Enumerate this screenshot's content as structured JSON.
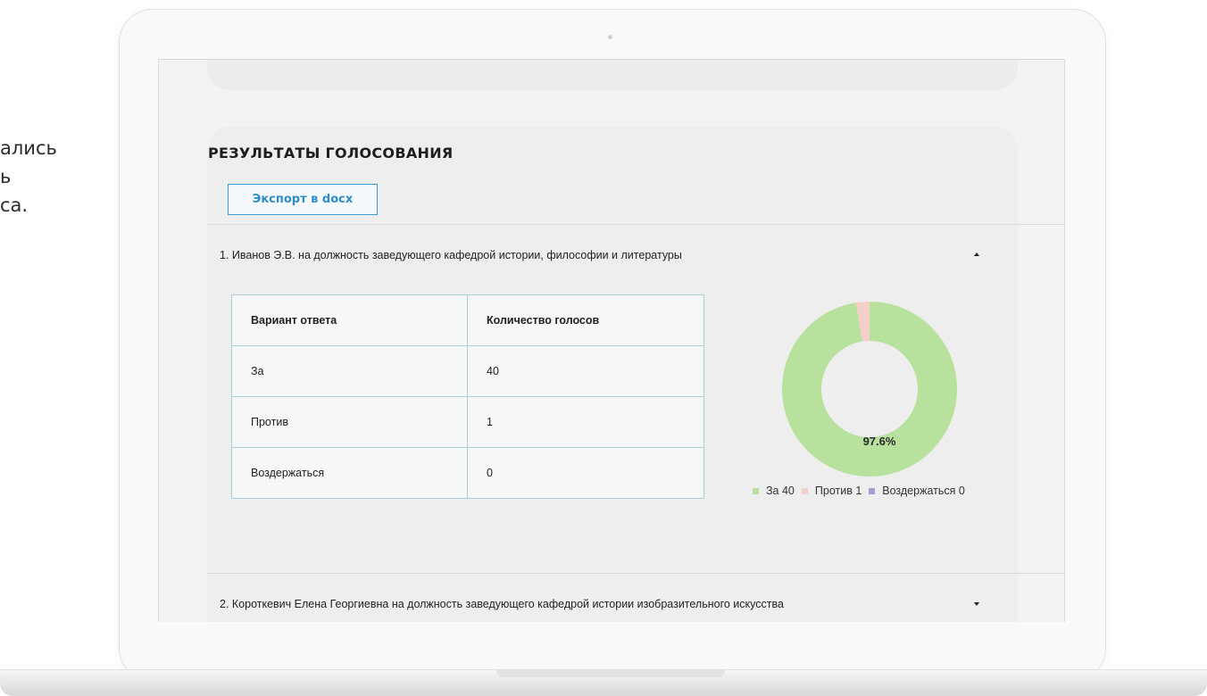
{
  "side_text": {
    "lines": [
      "ались",
      "ь",
      "",
      "са."
    ]
  },
  "results": {
    "title": "РЕЗУЛЬТАТЫ ГОЛОСОВАНИЯ",
    "export_label": "Экспорт в docx",
    "items": [
      {
        "title": "1. Иванов Э.В. на должность заведующего кафедрой истории, философии и литературы",
        "expanded": true,
        "table": {
          "headers": [
            "Вариант ответа",
            "Количество голосов"
          ],
          "rows": [
            [
              "За",
              "40"
            ],
            [
              "Против",
              "1"
            ],
            [
              "Воздержаться",
              "0"
            ]
          ]
        }
      },
      {
        "title": "2. Короткевич Елена Георгиевна на должность заведующего кафедрой истории изобразительного искусства",
        "expanded": false
      }
    ]
  },
  "chart_data": {
    "type": "pie",
    "categories": [
      "За",
      "Против",
      "Воздержаться"
    ],
    "values": [
      40,
      1,
      0
    ],
    "colors": [
      "#b7e19c",
      "#f4cfc9",
      "#a3a0cf"
    ],
    "slice_label": "97.6%",
    "legend_labels": [
      "За 40",
      "Против 1",
      "Воздержаться 0"
    ],
    "legend_position": "bottom"
  }
}
